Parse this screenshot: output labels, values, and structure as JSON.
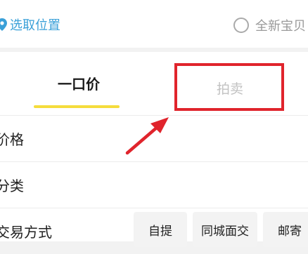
{
  "location": {
    "label": "选取位置",
    "icon": "location-pin-icon"
  },
  "condition": {
    "label": "全新宝贝",
    "checked": false
  },
  "tabs": {
    "fixed_price": "一口价",
    "auction": "拍卖",
    "active": "fixed_price"
  },
  "fields": {
    "price": "价格",
    "category": "分类",
    "trade_method": "交易方式"
  },
  "trade_options": {
    "pickup": "自提",
    "local_meetup": "同城面交",
    "mail": "邮寄"
  },
  "colors": {
    "accent_blue": "#3aa0d8",
    "tab_underline_yellow": "#f5dc3c",
    "annotation_red": "#e0242c"
  }
}
